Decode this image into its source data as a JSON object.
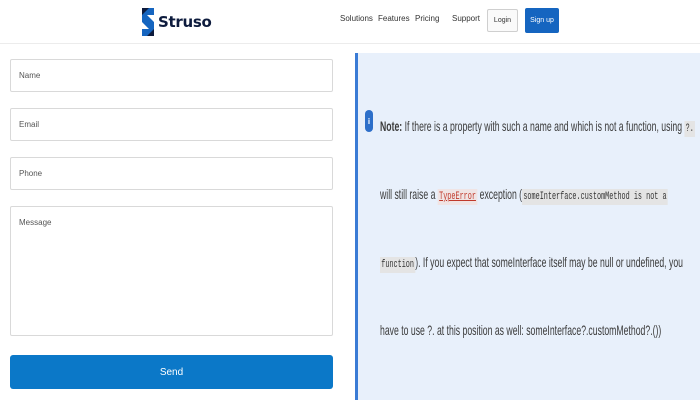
{
  "header": {
    "brand": "Struso",
    "nav": [
      "Solutions",
      "Features",
      "Pricing",
      "Support"
    ],
    "login_label": "Login",
    "signup_label": "Sign up",
    "colors": {
      "brand_blue": "#1565c0",
      "brand_dark": "#0d1b3d"
    }
  },
  "form": {
    "name_placeholder": "Name",
    "email_placeholder": "Email",
    "phone_placeholder": "Phone",
    "message_placeholder": "Message",
    "send_label": "Send"
  },
  "note": {
    "icon": "info-icon",
    "bold": "Note:",
    "l1_text": " If there is a property with such a name and which is not a function, using ",
    "l1_code": "?.",
    "l2_text_a": "will still raise a ",
    "l2_code_err": "TypeError",
    "l2_text_b": " exception (",
    "l2_code": "someInterface.customMethod is not a",
    "l3_code": "function",
    "l3_text": "). If you expect that someInterface itself may be null or undefined, you",
    "l4_text": "have to use ?. at this position as well: someInterface?.customMethod?.())"
  }
}
